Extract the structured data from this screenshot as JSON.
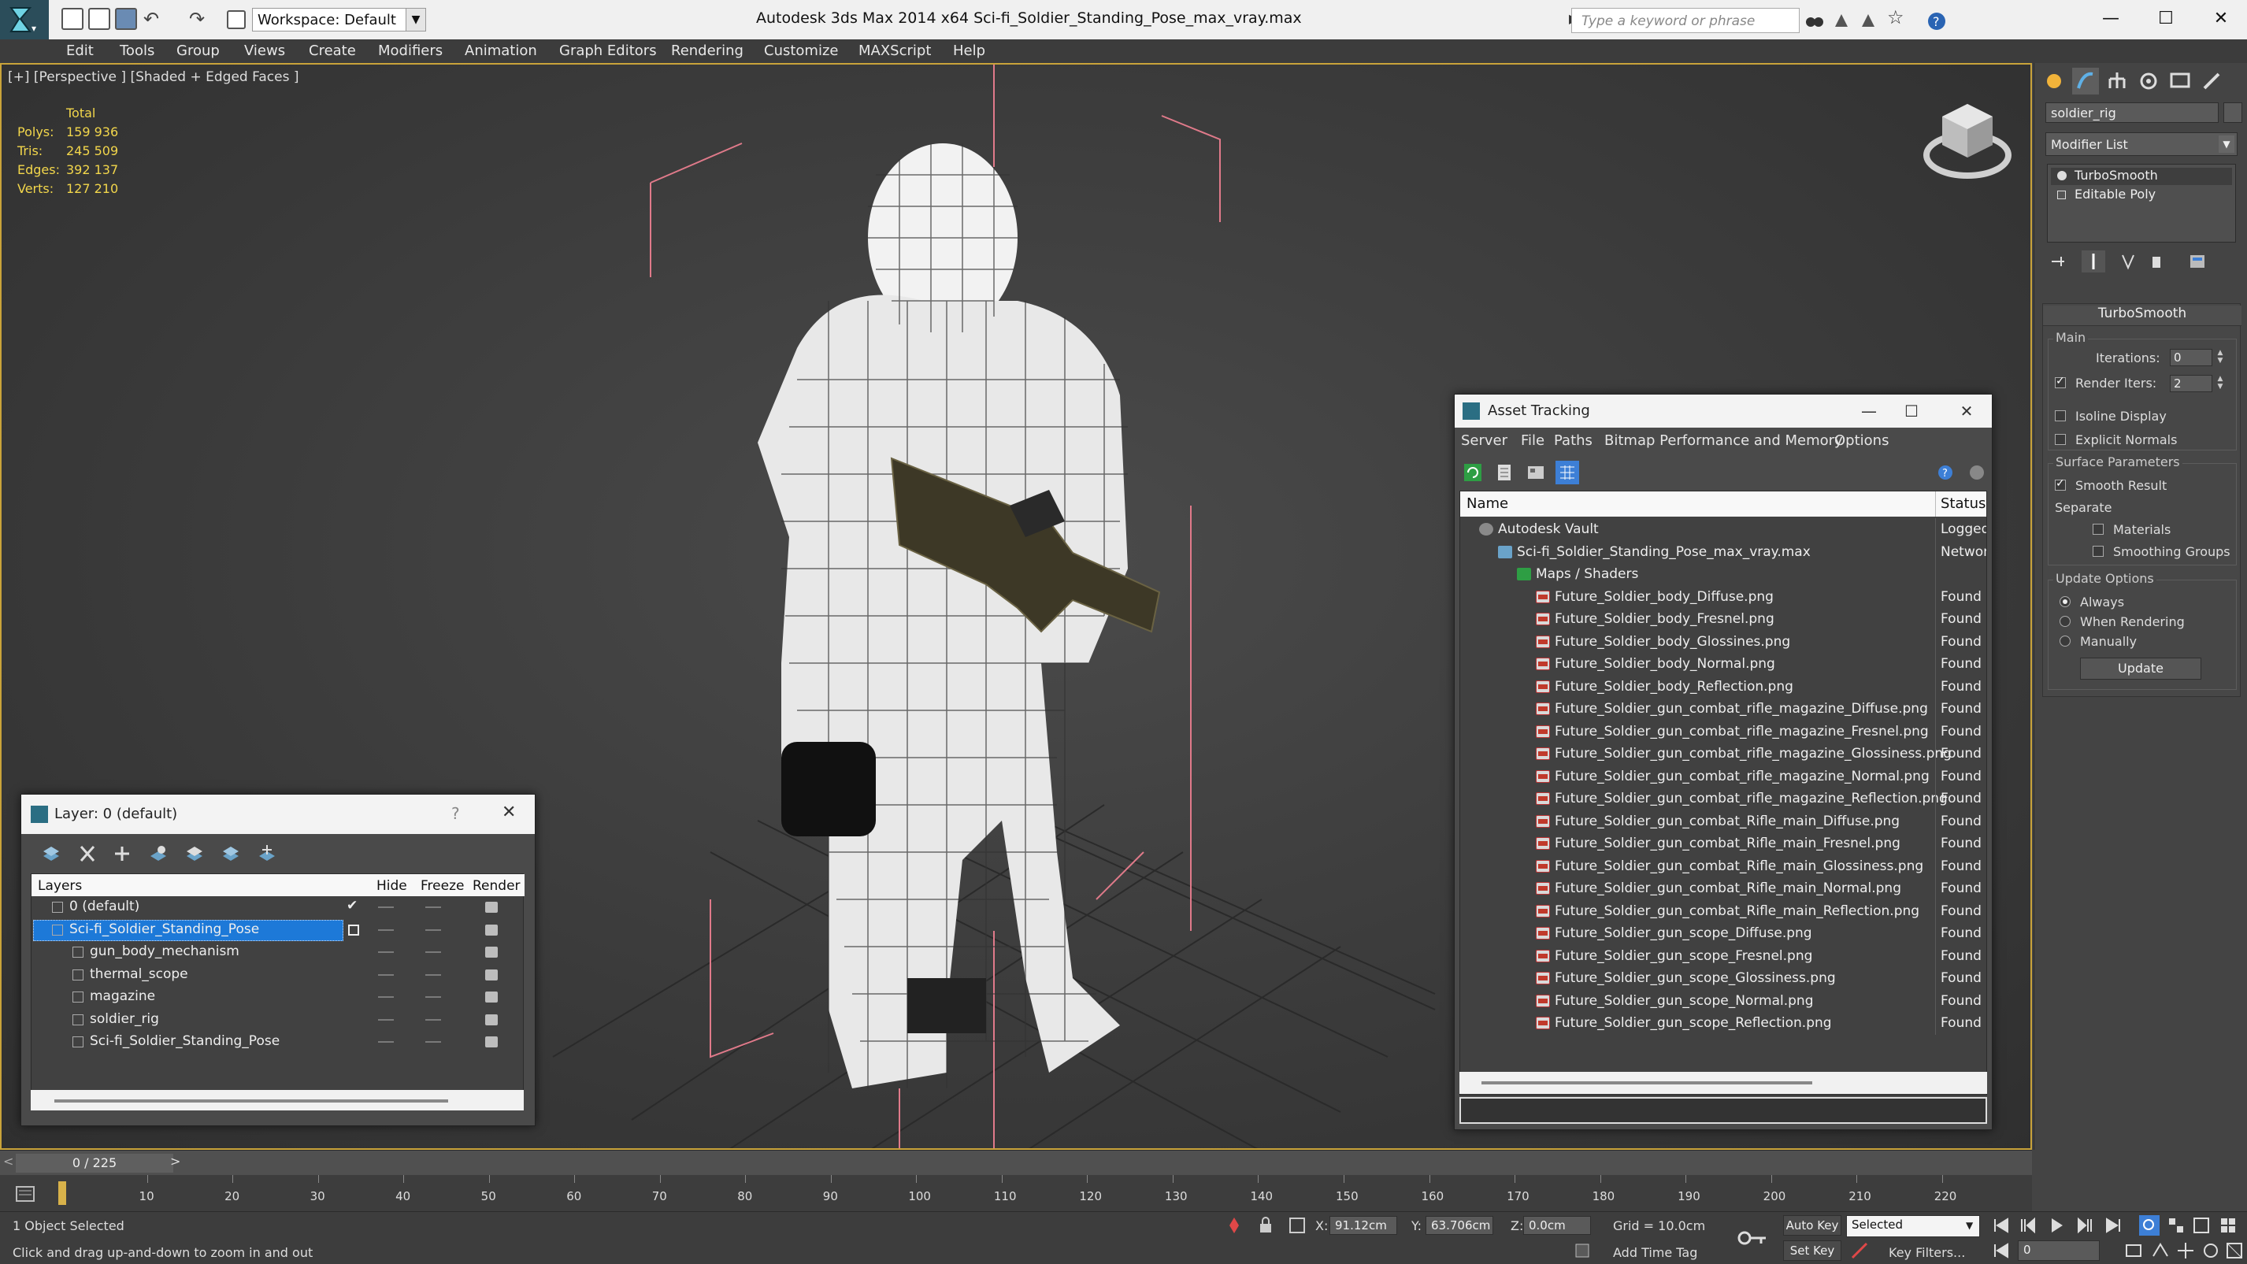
{
  "titlebar": {
    "workspace": "Workspace: Default",
    "title": "Autodesk 3ds Max  2014 x64      Sci-fi_Soldier_Standing_Pose_max_vray.max",
    "search_placeholder": "Type a keyword or phrase"
  },
  "menu": [
    "Edit",
    "Tools",
    "Group",
    "Views",
    "Create",
    "Modifiers",
    "Animation",
    "Graph Editors",
    "Rendering",
    "Customize",
    "MAXScript",
    "Help"
  ],
  "viewport": {
    "label": "[+] [Perspective ] [Shaded + Edged Faces ]",
    "stats_header": "Total",
    "stats": [
      {
        "label": "Polys:",
        "value": "159 936"
      },
      {
        "label": "Tris:",
        "value": "245 509"
      },
      {
        "label": "Edges:",
        "value": "392 137"
      },
      {
        "label": "Verts:",
        "value": "127 210"
      }
    ]
  },
  "command_panel": {
    "object_name": "soldier_rig",
    "modifier_list": "Modifier List",
    "stack": [
      "TurboSmooth",
      "Editable Poly"
    ],
    "rollout_title": "TurboSmooth",
    "main_group": "Main",
    "iterations_label": "Iterations:",
    "iterations_value": "0",
    "render_iters_label": "Render Iters:",
    "render_iters_value": "2",
    "isoline": "Isoline Display",
    "explicit": "Explicit Normals",
    "surface_group": "Surface Parameters",
    "smooth_result": "Smooth Result",
    "separate": "Separate",
    "materials": "Materials",
    "smoothing_groups": "Smoothing Groups",
    "update_group": "Update Options",
    "always": "Always",
    "when_rendering": "When Rendering",
    "manually": "Manually",
    "update_btn": "Update"
  },
  "asset_tracking": {
    "title": "Asset Tracking",
    "menu": [
      "Server",
      "File",
      "Paths",
      "Bitmap Performance and Memory",
      "Options"
    ],
    "col_name": "Name",
    "col_status": "Status",
    "rows": [
      {
        "name": "Autodesk Vault",
        "status": "Logged",
        "kind": "vault",
        "indent": 0
      },
      {
        "name": "Sci-fi_Soldier_Standing_Pose_max_vray.max",
        "status": "Networ",
        "kind": "max",
        "indent": 1
      },
      {
        "name": "Maps / Shaders",
        "status": "",
        "kind": "maps",
        "indent": 2
      },
      {
        "name": "Future_Soldier_body_Diffuse.png",
        "status": "Found",
        "kind": "png",
        "indent": 3
      },
      {
        "name": "Future_Soldier_body_Fresnel.png",
        "status": "Found",
        "kind": "png",
        "indent": 3
      },
      {
        "name": "Future_Soldier_body_Glossines.png",
        "status": "Found",
        "kind": "png",
        "indent": 3
      },
      {
        "name": "Future_Soldier_body_Normal.png",
        "status": "Found",
        "kind": "png",
        "indent": 3
      },
      {
        "name": "Future_Soldier_body_Reflection.png",
        "status": "Found",
        "kind": "png",
        "indent": 3
      },
      {
        "name": "Future_Soldier_gun_combat_rifle_magazine_Diffuse.png",
        "status": "Found",
        "kind": "png",
        "indent": 3
      },
      {
        "name": "Future_Soldier_gun_combat_rifle_magazine_Fresnel.png",
        "status": "Found",
        "kind": "png",
        "indent": 3
      },
      {
        "name": "Future_Soldier_gun_combat_rifle_magazine_Glossiness.png",
        "status": "Found",
        "kind": "png",
        "indent": 3
      },
      {
        "name": "Future_Soldier_gun_combat_rifle_magazine_Normal.png",
        "status": "Found",
        "kind": "png",
        "indent": 3
      },
      {
        "name": "Future_Soldier_gun_combat_rifle_magazine_Reflection.png",
        "status": "Found",
        "kind": "png",
        "indent": 3
      },
      {
        "name": "Future_Soldier_gun_combat_Rifle_main_Diffuse.png",
        "status": "Found",
        "kind": "png",
        "indent": 3
      },
      {
        "name": "Future_Soldier_gun_combat_Rifle_main_Fresnel.png",
        "status": "Found",
        "kind": "png",
        "indent": 3
      },
      {
        "name": "Future_Soldier_gun_combat_Rifle_main_Glossiness.png",
        "status": "Found",
        "kind": "png",
        "indent": 3
      },
      {
        "name": "Future_Soldier_gun_combat_Rifle_main_Normal.png",
        "status": "Found",
        "kind": "png",
        "indent": 3
      },
      {
        "name": "Future_Soldier_gun_combat_Rifle_main_Reflection.png",
        "status": "Found",
        "kind": "png",
        "indent": 3
      },
      {
        "name": "Future_Soldier_gun_scope_Diffuse.png",
        "status": "Found",
        "kind": "png",
        "indent": 3
      },
      {
        "name": "Future_Soldier_gun_scope_Fresnel.png",
        "status": "Found",
        "kind": "png",
        "indent": 3
      },
      {
        "name": "Future_Soldier_gun_scope_Glossiness.png",
        "status": "Found",
        "kind": "png",
        "indent": 3
      },
      {
        "name": "Future_Soldier_gun_scope_Normal.png",
        "status": "Found",
        "kind": "png",
        "indent": 3
      },
      {
        "name": "Future_Soldier_gun_scope_Reflection.png",
        "status": "Found",
        "kind": "png",
        "indent": 3
      }
    ]
  },
  "layers": {
    "title": "Layer: 0 (default)",
    "help": "?",
    "col_layers": "Layers",
    "col_hide": "Hide",
    "col_freeze": "Freeze",
    "col_render": "Render",
    "rows": [
      {
        "name": "0 (default)",
        "level": 0,
        "selected": false,
        "current": true
      },
      {
        "name": "Sci-fi_Soldier_Standing_Pose",
        "level": 0,
        "selected": true,
        "current": false
      },
      {
        "name": "gun_body_mechanism",
        "level": 1,
        "selected": false,
        "current": false
      },
      {
        "name": "thermal_scope",
        "level": 1,
        "selected": false,
        "current": false
      },
      {
        "name": "magazine",
        "level": 1,
        "selected": false,
        "current": false
      },
      {
        "name": "soldier_rig",
        "level": 1,
        "selected": false,
        "current": false
      },
      {
        "name": "Sci-fi_Soldier_Standing_Pose",
        "level": 1,
        "selected": false,
        "current": false
      }
    ]
  },
  "timeline": {
    "frame": "0 / 225",
    "ticks": [
      "10",
      "20",
      "30",
      "40",
      "50",
      "60",
      "70",
      "80",
      "90",
      "100",
      "110",
      "120",
      "130",
      "140",
      "150",
      "160",
      "170",
      "180",
      "190",
      "200",
      "210",
      "220"
    ]
  },
  "status": {
    "selection": "1 Object Selected",
    "prompt": "Click and drag up-and-down to zoom in and out",
    "x_label": "X:",
    "x_value": "91.12cm",
    "y_label": "Y:",
    "y_value": "63.706cm",
    "z_label": "Z:",
    "z_value": "0.0cm",
    "grid": "Grid = 10.0cm",
    "auto_key": "Auto Key",
    "selected": "Selected",
    "set_key": "Set Key",
    "key_filters": "Key Filters...",
    "add_time_tag": "Add Time Tag",
    "frame_field": "0"
  }
}
